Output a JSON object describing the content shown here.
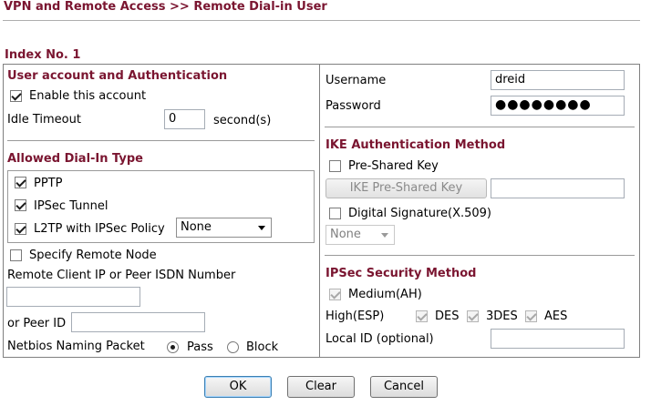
{
  "page": {
    "title": "VPN and Remote Access >> Remote Dial-in User",
    "index_label": "Index No. 1"
  },
  "account": {
    "section_title": "User account and Authentication",
    "enable_label": "Enable this account",
    "enable_checked": true,
    "idle_timeout_label": "Idle Timeout",
    "idle_timeout_value": "0",
    "idle_timeout_unit": "second(s)"
  },
  "dialin": {
    "section_title": "Allowed Dial-In Type",
    "pptp_label": "PPTP",
    "ipsec_label": "IPSec Tunnel",
    "l2tp_label": "L2TP with IPSec Policy",
    "l2tp_policy_value": "None",
    "specify_node_label": "Specify Remote Node",
    "remote_ip_label": "Remote Client IP or Peer ISDN Number",
    "remote_ip_value": "",
    "peer_id_label": "or Peer ID",
    "peer_id_value": "",
    "netbios_label": "Netbios Naming Packet",
    "pass_label": "Pass",
    "block_label": "Block"
  },
  "credentials": {
    "username_label": "Username",
    "username_value": "dreid",
    "password_label": "Password",
    "password_value": "●●●●●●●●"
  },
  "ike": {
    "section_title": "IKE Authentication Method",
    "psk_label": "Pre-Shared Key",
    "psk_button_label": "IKE Pre-Shared Key",
    "psk_value": "",
    "digital_sig_label": "Digital Signature(X.509)",
    "cert_select_value": "None"
  },
  "ipsec": {
    "section_title": "IPSec Security Method",
    "medium_label": "Medium(AH)",
    "high_label": "High(ESP)",
    "des_label": "DES",
    "3des_label": "3DES",
    "aes_label": "AES",
    "local_id_label": "Local ID (optional)",
    "local_id_value": ""
  },
  "footer": {
    "ok_label": "OK",
    "clear_label": "Clear",
    "cancel_label": "Cancel"
  }
}
